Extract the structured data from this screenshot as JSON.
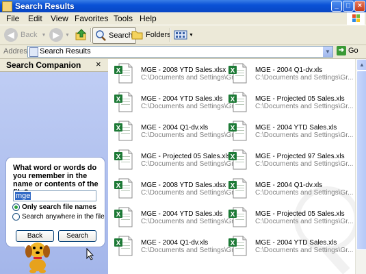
{
  "window": {
    "title": "Search Results"
  },
  "menubar": {
    "items": [
      "File",
      "Edit",
      "View",
      "Favorites",
      "Tools",
      "Help"
    ]
  },
  "toolbar": {
    "back_label": "Back",
    "search_label": "Search",
    "folders_label": "Folders"
  },
  "address": {
    "label": "Address",
    "value": "Search Results",
    "go_label": "Go"
  },
  "companion": {
    "title": "Search Companion",
    "question": "What word or words do you remember in the name or contents of the file?",
    "input_value": "mge",
    "option1": "Only search file names",
    "option2": "Search anywhere in the file",
    "selected_option": 1,
    "back_button": "Back",
    "search_button": "Search"
  },
  "colors": {
    "titlebar": "#0a52d6",
    "companion_bg": "#a4b6ea",
    "excel_green": "#1d7a36"
  },
  "files": [
    {
      "name": "MGE - 2008 YTD Sales.xlsx",
      "path": "C:\\Documents and Settings\\Gr..."
    },
    {
      "name": "MGE - 2004 Q1-dv.xls",
      "path": "C:\\Documents and Settings\\Gr..."
    },
    {
      "name": "MGE - 2004 YTD Sales.xls",
      "path": "C:\\Documents and Settings\\Gr..."
    },
    {
      "name": "MGE - Projected 05 Sales.xls",
      "path": "C:\\Documents and Settings\\Gr..."
    },
    {
      "name": "MGE - 2004 Q1-dv.xls",
      "path": "C:\\Documents and Settings\\Gr..."
    },
    {
      "name": "MGE - 2004 YTD Sales.xls",
      "path": "C:\\Documents and Settings\\Gr..."
    },
    {
      "name": "MGE - Projected 05 Sales.xls",
      "path": "C:\\Documents and Settings\\Gr..."
    },
    {
      "name": "MGE - Projected 97 Sales.xls",
      "path": "C:\\Documents and Settings\\Gr..."
    },
    {
      "name": "MGE - 2008 YTD Sales.xlsx",
      "path": "C:\\Documents and Settings\\Gr..."
    },
    {
      "name": "MGE - 2004 Q1-dv.xls",
      "path": "C:\\Documents and Settings\\Gr..."
    },
    {
      "name": "MGE - 2004 YTD Sales.xls",
      "path": "C:\\Documents and Settings\\Gr..."
    },
    {
      "name": "MGE - Projected 05 Sales.xls",
      "path": "C:\\Documents and Settings\\Gr..."
    },
    {
      "name": "MGE - 2004 Q1-dv.xls",
      "path": "C:\\Documents and Settings\\Gr..."
    },
    {
      "name": "MGE - 2004 YTD Sales.xls",
      "path": "C:\\Documents and Settings\\Gr..."
    }
  ]
}
